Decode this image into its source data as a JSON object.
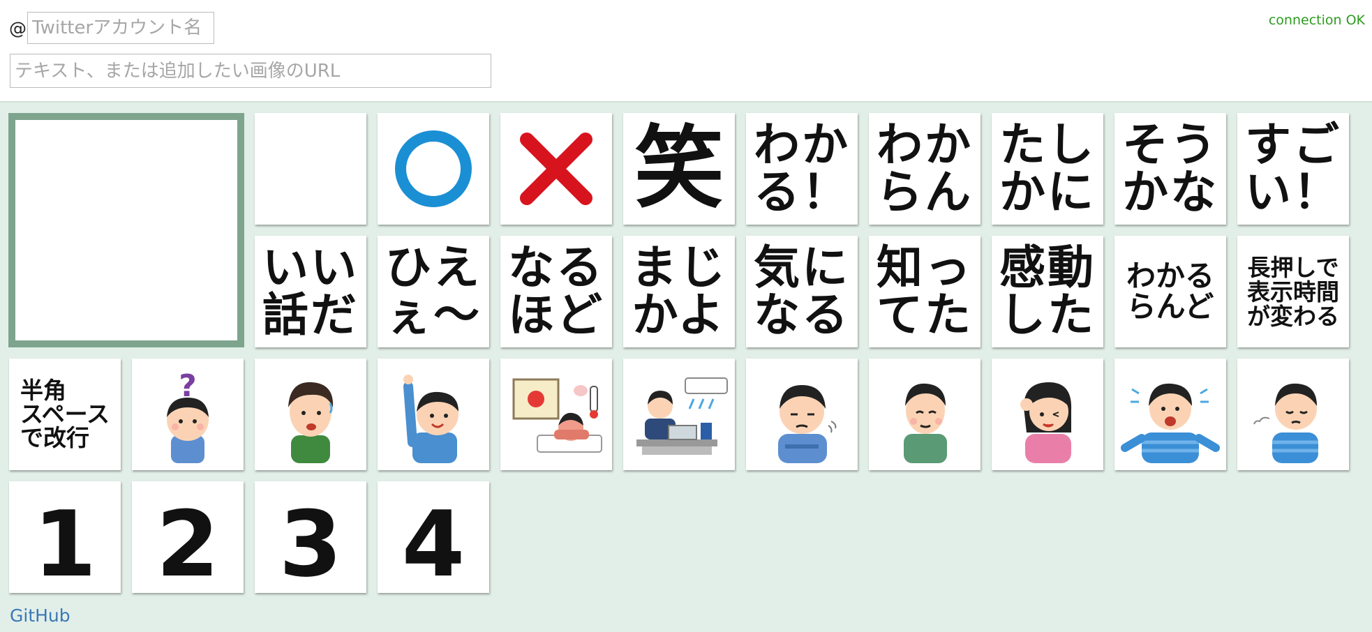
{
  "header": {
    "at_symbol": "@",
    "account_placeholder": "Twitterアカウント名",
    "text_placeholder": "テキスト、または追加したい画像のURL",
    "connection_status": "connection OK"
  },
  "colors": {
    "background": "#e2efe9",
    "preview_border": "#7ea48e",
    "circle": "#1b8fd4",
    "cross": "#d7141e",
    "status": "#2e9b1f",
    "link": "#3a78b6"
  },
  "row1": [
    {
      "label": ""
    },
    {
      "icon": "circle-mark-icon"
    },
    {
      "icon": "cross-mark-icon"
    },
    {
      "label": "笑"
    },
    {
      "label": "わか\nる！"
    },
    {
      "label": "わか\nらん"
    },
    {
      "label": "たし\nかに"
    },
    {
      "label": "そう\nかな"
    },
    {
      "label": "すご\nい！"
    }
  ],
  "row2": [
    {
      "label": "いい\n話だ"
    },
    {
      "label": "ひえ\nぇ〜"
    },
    {
      "label": "なる\nほど"
    },
    {
      "label": "まじ\nかよ"
    },
    {
      "label": "気に\nなる"
    },
    {
      "label": "知っ\nてた"
    },
    {
      "label": "感動\nした"
    },
    {
      "label": "わかる\nらんど"
    },
    {
      "label": "長押しで\n表示時間\nが変わる"
    }
  ],
  "row3": [
    {
      "label": "半角\nスペース\nで改行"
    },
    {
      "icon": "confused-boy-icon"
    },
    {
      "icon": "worried-man-icon"
    },
    {
      "icon": "raising-hand-man-icon"
    },
    {
      "icon": "heatstroke-person-icon"
    },
    {
      "icon": "office-aircon-worker-icon"
    },
    {
      "icon": "troubled-man-icon"
    },
    {
      "icon": "relieved-man-icon"
    },
    {
      "icon": "embarrassed-woman-icon"
    },
    {
      "icon": "shocked-man-icon"
    },
    {
      "icon": "sighing-man-icon"
    }
  ],
  "row4": [
    {
      "label": "1"
    },
    {
      "label": "2"
    },
    {
      "label": "3"
    },
    {
      "label": "4"
    }
  ],
  "footer": {
    "github_label": "GitHub"
  }
}
